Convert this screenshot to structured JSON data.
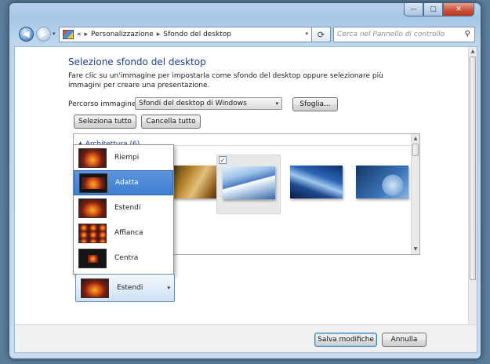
{
  "window": {
    "controls": {
      "minimize": "—",
      "maximize": "▢",
      "close": "✕"
    }
  },
  "nav": {
    "back_glyph": "◀",
    "forward_glyph": "▶",
    "history_glyph": "▾",
    "icon": "control-panel-icon",
    "breadcrumb_prefix": "«",
    "breadcrumb": [
      "Personalizzazione",
      "Sfondo del desktop"
    ],
    "breadcrumb_sep": "▸",
    "address_dropdown_glyph": "▾",
    "refresh_glyph": "⟳",
    "search_placeholder": "Cerca nel Pannello di controllo",
    "search_icon_glyph": "⚲"
  },
  "main": {
    "title": "Selezione sfondo del desktop",
    "description": "Fare clic su un'immagine per impostarla come sfondo del desktop oppure selezionare più immagini per creare una presentazione.",
    "path_label": "Percorso immagine:",
    "path_value": "Sfondi del desktop di Windows",
    "path_arrow": "▾",
    "browse_label": "Sfoglia...",
    "select_all_label": "Seleziona tutto",
    "clear_all_label": "Cancella tutto",
    "group_label": "▲ Architettura (6)",
    "selected_check": "✓",
    "position_options": [
      {
        "label": "Riempi",
        "selected": false
      },
      {
        "label": "Adatta",
        "selected": true
      },
      {
        "label": "Estendi",
        "selected": false
      },
      {
        "label": "Affianca",
        "selected": false
      },
      {
        "label": "Centra",
        "selected": false
      }
    ],
    "position_current": "Estendi",
    "position_arrow": "▾"
  },
  "footer": {
    "save_label": "Salva modifiche",
    "cancel_label": "Annulla"
  },
  "colors": {
    "accent_selected": "#3f7ed2",
    "title_blue": "#1e3e8a",
    "close_red": "#c9513b"
  }
}
